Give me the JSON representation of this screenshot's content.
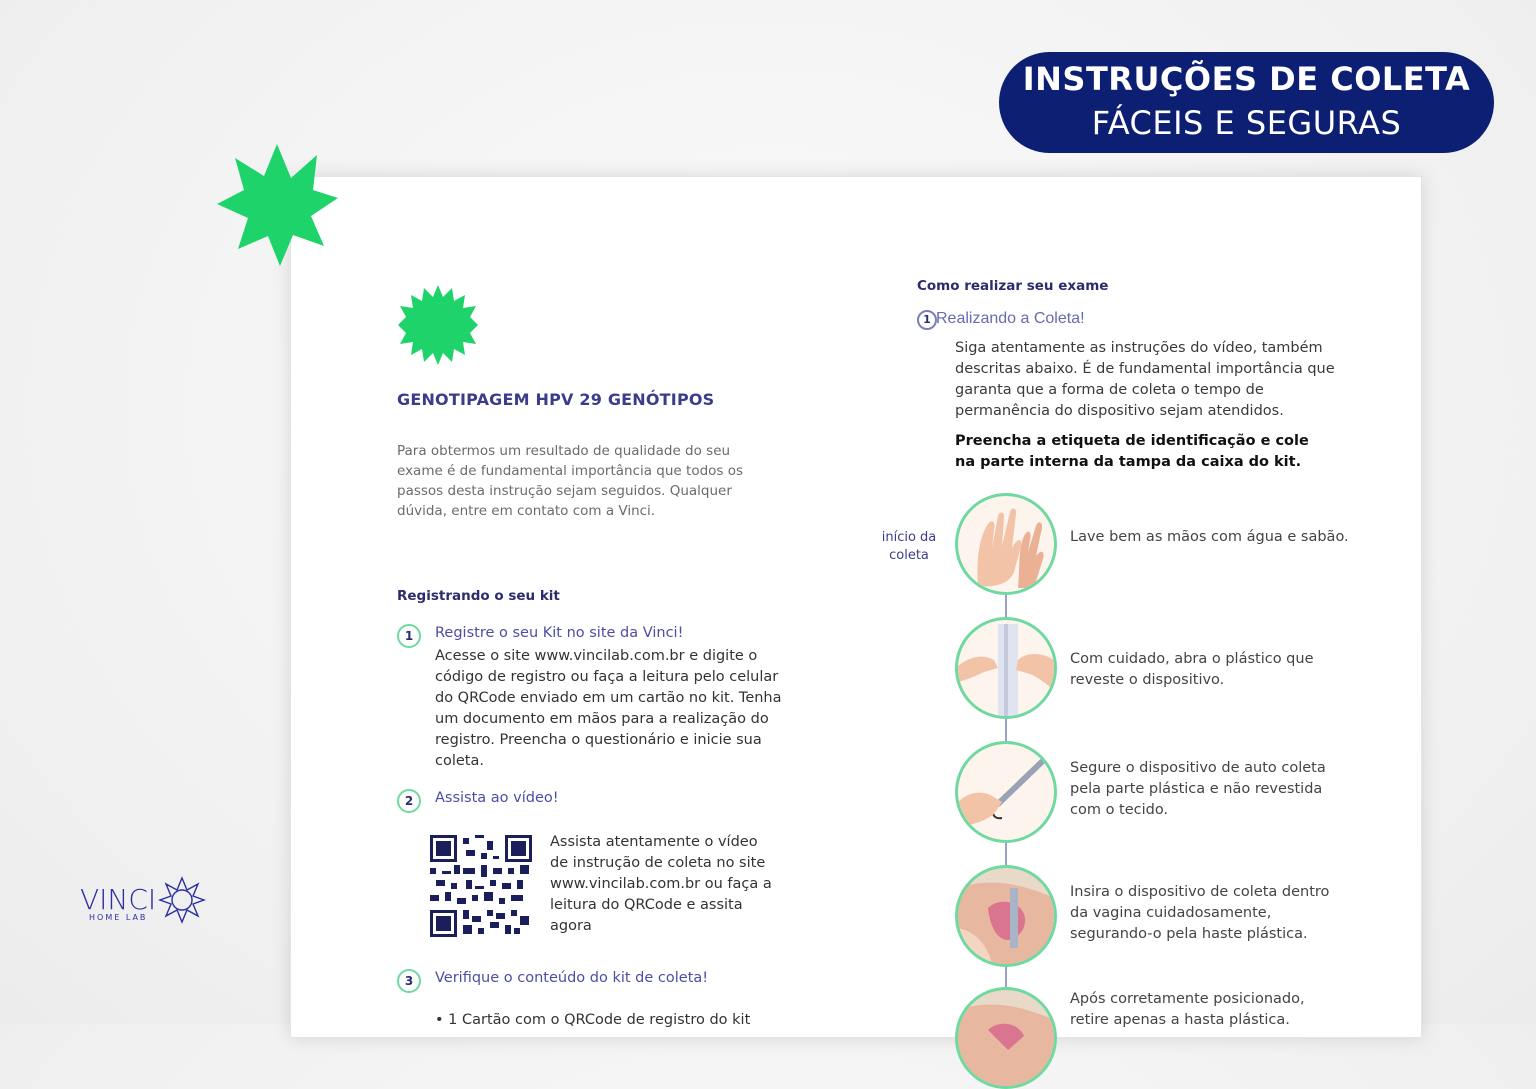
{
  "badge": {
    "line1": "INSTRUÇÕES DE COLETA",
    "line2": "FÁCEIS E SEGURAS"
  },
  "document": {
    "title": "GENOTIPAGEM HPV 29 GENÓTIPOS",
    "intro": "Para obtermos um resultado de qualidade do seu exame é de fundamental importância que todos os passos desta instrução sejam seguidos. Qualquer dúvida, entre em contato com a Vinci.",
    "register_section": {
      "heading": "Registrando o seu kit",
      "steps": [
        {
          "number": "1",
          "title": "Registre o seu Kit no site da Vinci!",
          "body": "Acesse o site www.vincilab.com.br e digite o código de registro ou faça a leitura pelo celular do QRCode enviado em um cartão no kit. Tenha um documento em mãos para a realização do registro. Preencha o questionário e inicie sua coleta."
        },
        {
          "number": "2",
          "title": "Assista ao vídeo!",
          "body": "Assista atentamente o vídeo de instrução de coleta no site www.vincilab.com.br ou faça a leitura do QRCode e assita agora"
        },
        {
          "number": "3",
          "title": "Verifique o conteúdo do kit de coleta!",
          "body": "• 1 Cartão com o QRCode de registro do kit"
        }
      ]
    },
    "exam_section": {
      "heading": "Como realizar seu exame",
      "step_number": "1",
      "step_title": "Realizando a Coleta!",
      "body": "Siga atentamente as instruções do vídeo, também descritas abaixo. É de fundamental importância que garanta que a forma de coleta o tempo de permanência do dispositivo sejam atendidos.",
      "bold_note": "Preencha a etiqueta de identificação e cole na parte interna da tampa da caixa do kit.",
      "start_label": "início da coleta",
      "instructions": [
        {
          "text": "Lave bem as mãos com água e sabão.",
          "icon": "hand-washing-icon"
        },
        {
          "text": "Com cuidado, abra o plástico que reveste o dispositivo.",
          "icon": "open-package-icon"
        },
        {
          "text": "Segure o dispositivo de auto coleta pela parte plástica e não revestida com o tecido.",
          "icon": "hold-device-icon"
        },
        {
          "text": "Insira o dispositivo de coleta dentro da vagina cuidadosamente, segurando-o pela haste plástica.",
          "icon": "insert-device-icon"
        },
        {
          "text": "Após corretamente posicionado, retire apenas a hasta plástica.",
          "icon": "remove-rod-icon"
        }
      ]
    }
  },
  "logo": {
    "name": "VINCI",
    "tagline": "HOME LAB"
  },
  "colors": {
    "navy": "#0d1f73",
    "green": "#1fd36b",
    "purple": "#3b3c8c",
    "ring": "#6fd9a0"
  }
}
